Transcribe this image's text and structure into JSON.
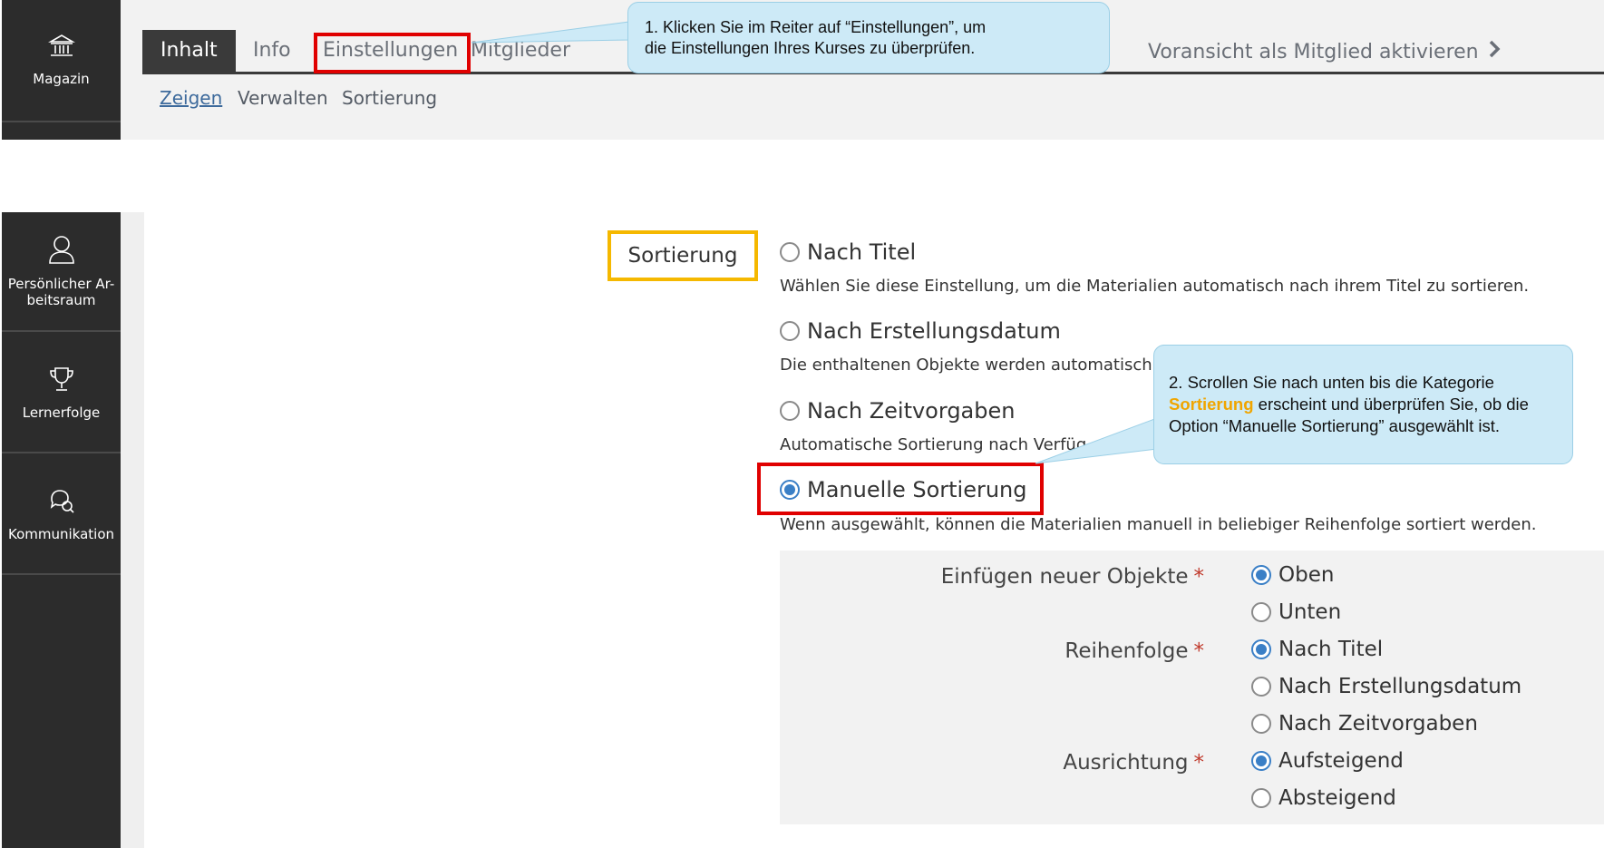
{
  "mainbar_top": {
    "label": "Magazin",
    "icon": "bank-icon"
  },
  "tabs": {
    "inhalt": "Inhalt",
    "info": "Info",
    "einstellungen": "Einstellungen",
    "mitglieder": "Mitglieder"
  },
  "preview_link": "Voransicht als Mitglied aktivieren",
  "subtabs": {
    "zeigen": "Zeigen",
    "verwalten": "Verwalten",
    "sortierung": "Sortierung"
  },
  "callout1": {
    "line1": "1. Klicken Sie im Reiter auf “Einstellungen”, um",
    "line2": "die Einstellungen Ihres Kurses zu überprüfen."
  },
  "callout2": {
    "before": "2. Scrollen Sie nach unten bis die Kategorie ",
    "keyword": "Sortierung",
    "after": " erscheint und überprüfen Sie, ob die Option “Manuelle Sortierung” ausgewählt ist."
  },
  "sidebar": {
    "items": [
      {
        "label": "Persönlicher Ar-\nbeitsraum",
        "icon": "user-icon"
      },
      {
        "label": "Lernerfolge",
        "icon": "trophy-icon"
      },
      {
        "label": "Kommunikation",
        "icon": "chat-icon"
      }
    ]
  },
  "form": {
    "section_label": "Sortierung",
    "options": [
      {
        "label": "Nach Titel",
        "desc": "Wählen Sie diese Einstellung, um die Materialien automatisch nach ihrem Titel zu sortieren.",
        "checked": false
      },
      {
        "label": "Nach Erstellungsdatum",
        "desc": "Die enthaltenen Objekte werden automatisch",
        "checked": false
      },
      {
        "label": "Nach Zeitvorgaben",
        "desc": "Automatische Sortierung nach Verfüg",
        "checked": false
      },
      {
        "label": "Manuelle Sortierung",
        "desc": "Wenn ausgewählt, können die Materialien manuell in beliebiger Reihenfolge sortiert werden.",
        "checked": true
      }
    ],
    "sub": {
      "insert_label": "Einfügen neuer Objekte",
      "insert_options": [
        "Oben",
        "Unten"
      ],
      "insert_selected": "Oben",
      "order_label": "Reihenfolge",
      "order_options": [
        "Nach Titel",
        "Nach Erstellungsdatum",
        "Nach Zeitvorgaben"
      ],
      "order_selected": "Nach Titel",
      "direction_label": "Ausrichtung",
      "direction_options": [
        "Aufsteigend",
        "Absteigend"
      ],
      "direction_selected": "Aufsteigend",
      "required_marker": "*"
    }
  },
  "colors": {
    "highlight_red": "#e00000",
    "highlight_yellow": "#f5b800",
    "callout_bg": "#cdeaf7",
    "radio_checked": "#3a7fc6",
    "sidebar_bg": "#2c2c2c"
  }
}
